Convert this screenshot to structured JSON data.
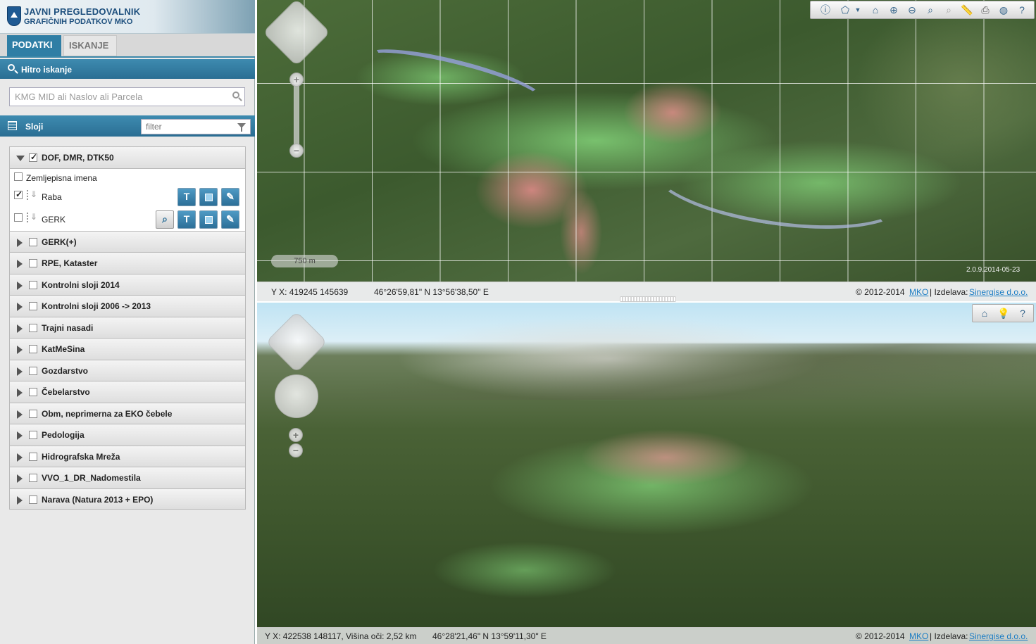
{
  "header": {
    "title_line1": "JAVNI PREGLEDOVALNIK",
    "title_line2": "GRAFIČNIH PODATKOV MKO"
  },
  "tabs": [
    {
      "label": "PODATKI",
      "active": true
    },
    {
      "label": "ISKANJE",
      "active": false
    }
  ],
  "quick_search": {
    "title": "Hitro iskanje",
    "placeholder": "KMG MID ali Naslov ali Parcela",
    "value": ""
  },
  "layers_panel": {
    "title": "Sloji",
    "filter_placeholder": "filter",
    "groups": [
      {
        "label": "DOF, DMR, DTK50",
        "checked": true,
        "expanded": true,
        "children": [
          {
            "label": "Zemljepisna imena",
            "checked": false
          },
          {
            "label": "Raba",
            "checked": true,
            "tools": [
              "text-icon",
              "legend-box-icon",
              "style-brush-icon"
            ]
          },
          {
            "label": "GERK",
            "checked": false,
            "tools": [
              "search-icon",
              "text-icon",
              "legend-box-icon",
              "style-brush-icon"
            ]
          }
        ]
      },
      {
        "label": "GERK(+)",
        "checked": false
      },
      {
        "label": "RPE, Kataster",
        "checked": false
      },
      {
        "label": "Kontrolni sloji 2014",
        "checked": false
      },
      {
        "label": "Kontrolni sloji 2006 -> 2013",
        "checked": false
      },
      {
        "label": "Trajni nasadi",
        "checked": false
      },
      {
        "label": "KatMeSina",
        "checked": false
      },
      {
        "label": "Gozdarstvo",
        "checked": false
      },
      {
        "label": "Čebelarstvo",
        "checked": false
      },
      {
        "label": "Obm, neprimerna za EKO čebele",
        "checked": false
      },
      {
        "label": "Pedologija",
        "checked": false
      },
      {
        "label": "Hidrografska Mreža",
        "checked": false
      },
      {
        "label": "VVO_1_DR_Nadomestila",
        "checked": false
      },
      {
        "label": "Narava (Natura 2013 + EPO)",
        "checked": false
      }
    ]
  },
  "map2d": {
    "scale_label": "750 m",
    "version": "2.0.9.2014-05-23",
    "toolbar": [
      "info-icon",
      "draw-polygon-icon",
      "dropdown-icon",
      "home-icon",
      "zoom-in-icon",
      "zoom-out-icon",
      "zoom-box-icon",
      "zoom-previous-icon",
      "measure-icon",
      "print-icon",
      "globe-icon",
      "help-icon"
    ],
    "status": {
      "coords_yx": "Y X: 419245 145639",
      "coords_latlon": "46°26'59,81\" N 13°56'38,50\" E",
      "copyright": "© 2012-2014",
      "link1": "MKO",
      "separator": "| Izdelava:",
      "link2": "Sinergise d.o.o."
    }
  },
  "map3d": {
    "toolbar": [
      "home-icon",
      "lightbulb-icon",
      "help-icon"
    ],
    "status": {
      "coords_yx": "Y X: 422538 148117, Višina oči: 2,52 km",
      "coords_latlon": "46°28'21,46\" N 13°59'11,30\" E",
      "copyright": "© 2012-2014",
      "link1": "MKO",
      "separator": "| Izdelava:",
      "link2": "Sinergise d.o.o."
    }
  }
}
